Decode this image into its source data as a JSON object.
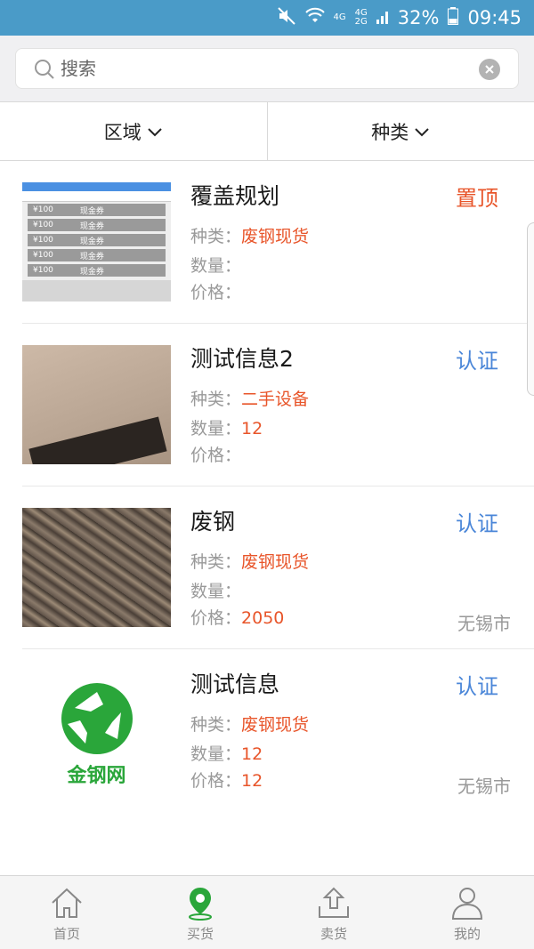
{
  "status": {
    "signal": "4G",
    "network_top": "4G",
    "network_bottom": "2G",
    "battery": "32%",
    "time": "09:45"
  },
  "search": {
    "placeholder": "搜索"
  },
  "filters": [
    {
      "label": "区域"
    },
    {
      "label": "种类"
    }
  ],
  "listing_labels": {
    "category": "种类：",
    "quantity": "数量：",
    "price": "价格："
  },
  "listings": [
    {
      "title": "覆盖规划",
      "badge": "置顶",
      "badge_color": "#e8552a",
      "category": "废钢现货",
      "quantity": "",
      "price": "",
      "city": "",
      "thumb_coupons": [
        "¥100",
        "¥100",
        "¥100",
        "¥100",
        "¥100"
      ],
      "thumb_coupon_label": "现金券"
    },
    {
      "title": "测试信息2",
      "badge": "认证",
      "badge_color": "#4a86d8",
      "category": "二手设备",
      "quantity": "12",
      "price": "",
      "city": ""
    },
    {
      "title": "废钢",
      "badge": "认证",
      "badge_color": "#4a86d8",
      "category": "废钢现货",
      "quantity": "",
      "price": "2050",
      "city": "无锡市"
    },
    {
      "title": "测试信息",
      "badge": "认证",
      "badge_color": "#4a86d8",
      "category": "废钢现货",
      "quantity": "12",
      "price": "12",
      "city": "无锡市",
      "logo_text": "金钢网"
    }
  ],
  "tabs": [
    {
      "label": "首页",
      "icon": "home-icon"
    },
    {
      "label": "买货",
      "icon": "location-pin-icon",
      "active": true
    },
    {
      "label": "卖货",
      "icon": "upload-icon"
    },
    {
      "label": "我的",
      "icon": "user-icon"
    }
  ],
  "colors": {
    "status_bar": "#4a9bc8",
    "accent_orange": "#e8552a",
    "accent_blue": "#4a86d8",
    "active_tab": "#2aa63a"
  }
}
